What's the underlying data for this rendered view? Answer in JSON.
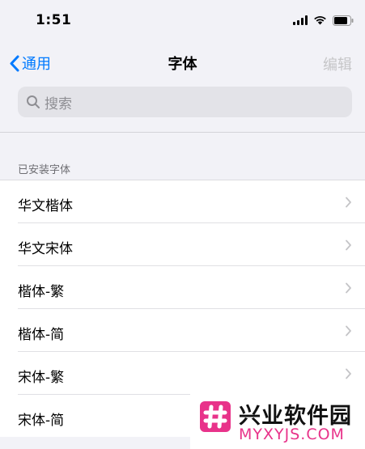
{
  "status_bar": {
    "time": "1:51"
  },
  "nav": {
    "back_label": "通用",
    "title": "字体",
    "edit_label": "编辑"
  },
  "search": {
    "placeholder": "搜索"
  },
  "section": {
    "header": "已安装字体"
  },
  "fonts": [
    {
      "label": "华文楷体"
    },
    {
      "label": "华文宋体"
    },
    {
      "label": "楷体-繁"
    },
    {
      "label": "楷体-简"
    },
    {
      "label": "宋体-繁"
    },
    {
      "label": "宋体-简"
    }
  ],
  "watermark": {
    "name": "兴业软件园",
    "url": "MYXYJS.COM"
  },
  "colors": {
    "accent": "#007aff",
    "disabled": "#c6c6c8",
    "background": "#f2f2f7",
    "watermark": "#e8338a"
  }
}
